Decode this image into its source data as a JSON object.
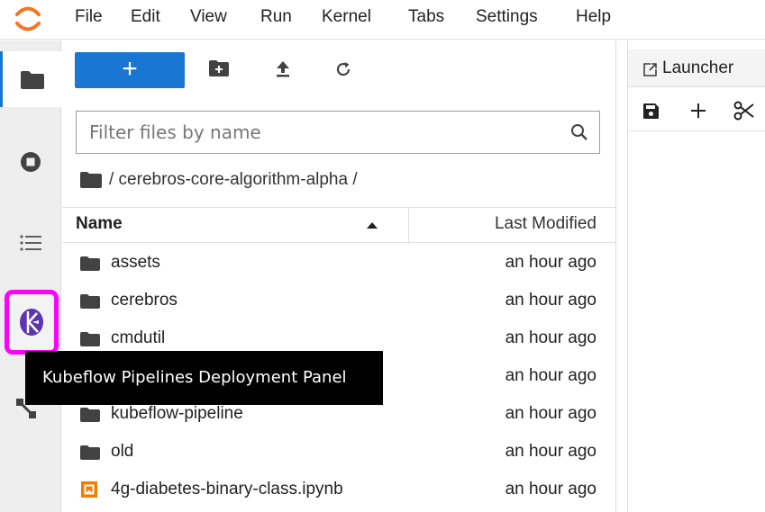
{
  "menu": [
    "File",
    "Edit",
    "View",
    "Run",
    "Kernel",
    "Tabs",
    "Settings",
    "Help"
  ],
  "filebrowser": {
    "new_label": "+",
    "filter_placeholder": "Filter files by name",
    "breadcrumb": "/ cerebros-core-algorithm-alpha /",
    "col_name": "Name",
    "col_modified": "Last Modified",
    "rows": [
      {
        "name": "assets",
        "modified": "an hour ago",
        "type": "folder"
      },
      {
        "name": "cerebros",
        "modified": "an hour ago",
        "type": "folder"
      },
      {
        "name": "cmdutil",
        "modified": "an hour ago",
        "type": "folder"
      },
      {
        "name": "",
        "modified": "an hour ago",
        "type": "folder"
      },
      {
        "name": "kubeflow-pipeline",
        "modified": "an hour ago",
        "type": "folder"
      },
      {
        "name": "old",
        "modified": "an hour ago",
        "type": "folder"
      },
      {
        "name": "4g-diabetes-binary-class.ipynb",
        "modified": "an hour ago",
        "type": "notebook"
      }
    ]
  },
  "launcher": {
    "tab_label": "Launcher"
  },
  "tooltip": "Kubeflow Pipelines Deployment Panel",
  "colors": {
    "accent": "#1976d2",
    "highlight": "#ff00ff",
    "notebook": "#f57c00",
    "kubeflow": "#5e35b1"
  }
}
